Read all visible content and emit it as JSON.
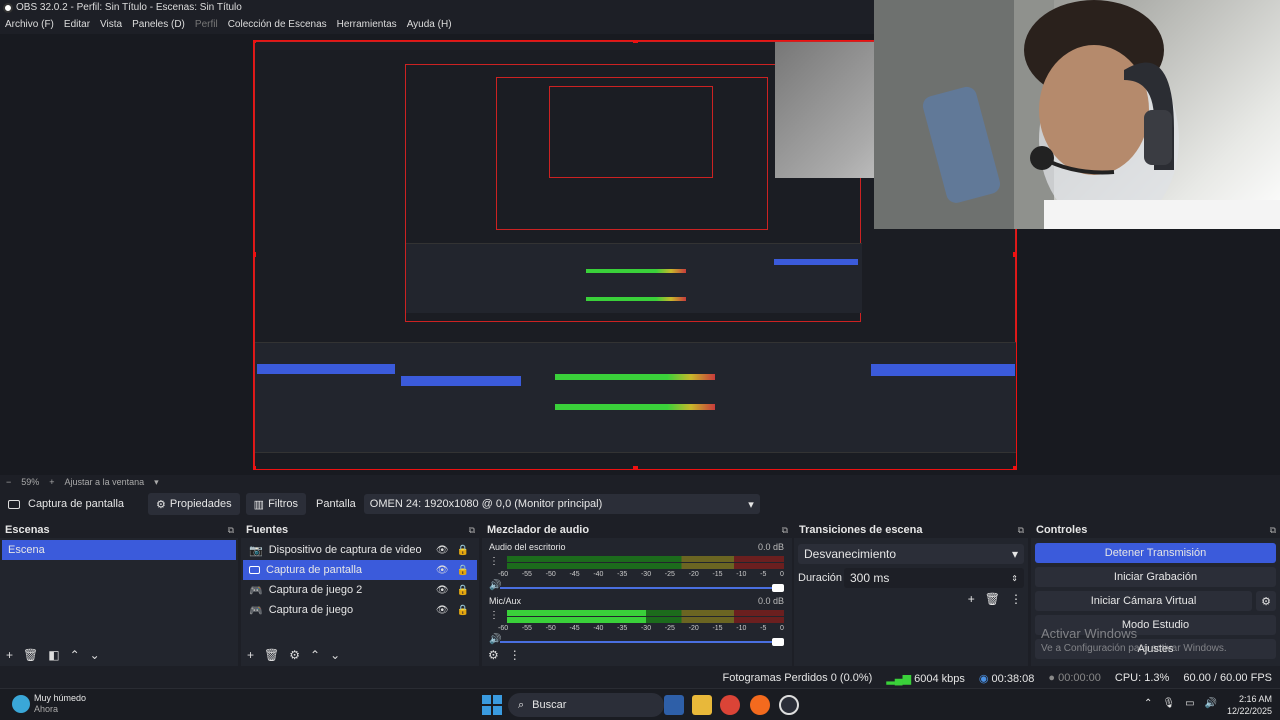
{
  "window": {
    "title": "OBS 32.0.2 - Perfil: Sin Título - Escenas: Sin Título"
  },
  "menu": [
    {
      "label": "Archivo (F)"
    },
    {
      "label": "Editar"
    },
    {
      "label": "Vista"
    },
    {
      "label": "Paneles (D)"
    },
    {
      "label": "Perfil",
      "disabled": true
    },
    {
      "label": "Colección de Escenas"
    },
    {
      "label": "Herramientas"
    },
    {
      "label": "Ayuda (H)"
    }
  ],
  "zoom": {
    "level": "59%",
    "fit_label": "Ajustar a la ventana"
  },
  "source_toolbar": {
    "source_name": "Captura de pantalla",
    "properties_label": "Propiedades",
    "filters_label": "Filtros",
    "display_label": "Pantalla",
    "display_value": "OMEN 24: 1920x1080 @ 0,0 (Monitor principal)"
  },
  "scenes": {
    "title": "Escenas",
    "items": [
      {
        "label": "Escena",
        "selected": true
      }
    ]
  },
  "sources": {
    "title": "Fuentes",
    "items": [
      {
        "label": "Dispositivo de captura de video",
        "icon": "camera-icon"
      },
      {
        "label": "Captura de pantalla",
        "icon": "monitor-icon",
        "selected": true
      },
      {
        "label": "Captura de juego 2",
        "icon": "gamepad-icon"
      },
      {
        "label": "Captura de juego",
        "icon": "gamepad-icon"
      }
    ]
  },
  "mixer": {
    "title": "Mezclador de audio",
    "ticks": [
      "-60",
      "-55",
      "-50",
      "-45",
      "-40",
      "-35",
      "-30",
      "-25",
      "-20",
      "-15",
      "-10",
      "-5",
      "0"
    ],
    "channels": [
      {
        "name": "Audio del escritorio",
        "db": "0.0 dB",
        "level": 0
      },
      {
        "name": "Mic/Aux",
        "db": "0.0 dB",
        "level": 0.5
      }
    ]
  },
  "transitions": {
    "title": "Transiciones de escena",
    "selected": "Desvanecimiento",
    "duration_label": "Duración",
    "duration_value": "300 ms"
  },
  "controls": {
    "title": "Controles",
    "stop_stream": "Detener Transmisión",
    "start_record": "Iniciar Grabación",
    "start_virtualcam": "Iniciar Cámara Virtual",
    "studio_mode": "Modo Estudio",
    "settings": "Ajustes"
  },
  "watermark": {
    "line1": "Activar Windows",
    "line2": "Ve a Configuración para activar Windows."
  },
  "status": {
    "dropped_frames": "Fotogramas Perdidos 0 (0.0%)",
    "bitrate": "6004 kbps",
    "stream_time": "00:38:08",
    "record_time": "00:00:00",
    "cpu": "CPU: 1.3%",
    "fps": "60.00 / 60.00 FPS"
  },
  "taskbar": {
    "weather_title": "Muy húmedo",
    "weather_sub": "Ahora",
    "search_placeholder": "Buscar",
    "time": "2:16 AM",
    "date": "12/22/2025"
  },
  "colors": {
    "accent": "#3b5bdb",
    "selection_border": "#ee1111",
    "background": "#1d1f26",
    "panel": "#22252d"
  }
}
